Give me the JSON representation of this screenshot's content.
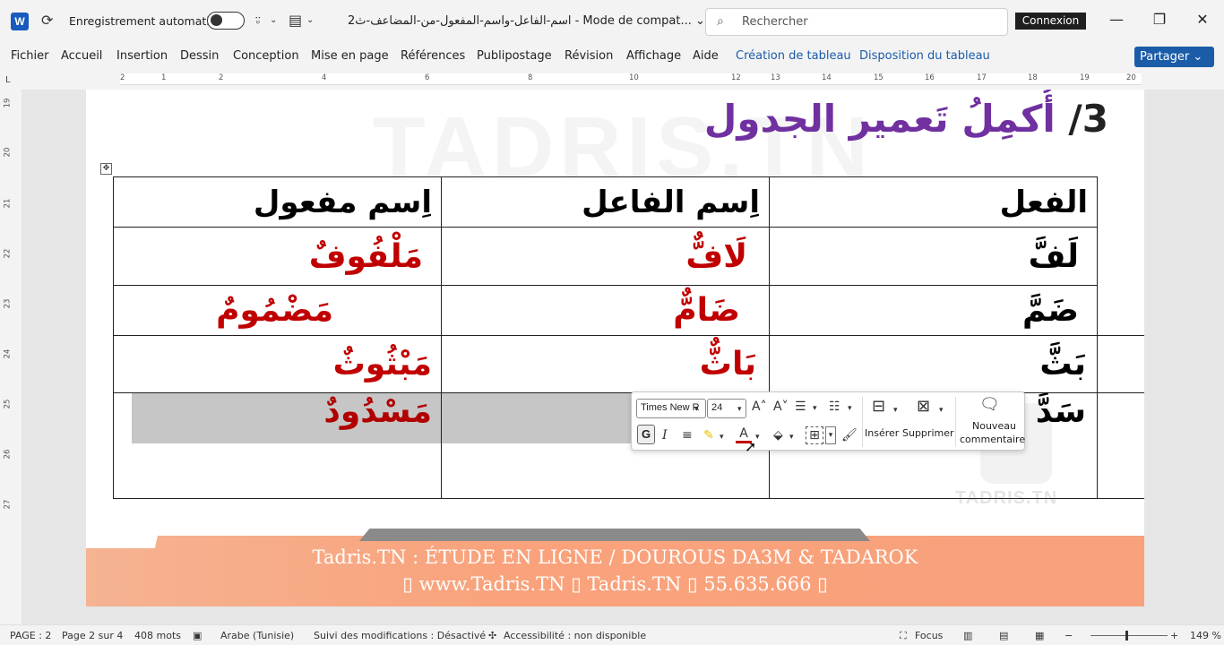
{
  "titlebar": {
    "autosave_label": "Enregistrement automatique",
    "doc_title": "اسم-الفاعل-واسم-المفعول-من-المضاعف-ث2  -  Mode de compat... ⌄",
    "search_placeholder": "Rechercher",
    "signin_label": "Connexion"
  },
  "tabs": [
    "Fichier",
    "Accueil",
    "Insertion",
    "Dessin",
    "Conception",
    "Mise en page",
    "Références",
    "Publipostage",
    "Révision",
    "Affichage",
    "Aide",
    "Création de tableau",
    "Disposition du tableau"
  ],
  "share_label": "Partager ⌄",
  "ruler": {
    "h": [
      "2",
      "1",
      "2",
      "4",
      "6",
      "8",
      "10",
      "12",
      "13",
      "14",
      "15",
      "16",
      "17",
      "18",
      "19",
      "20"
    ],
    "v": [
      "19",
      "20",
      "21",
      "22",
      "23",
      "24",
      "25",
      "26",
      "27"
    ]
  },
  "document": {
    "watermark": "TADRIS.TN",
    "heading_number": "3/",
    "heading_text": "أُكمِلُ تَعمير الجدول",
    "table": {
      "headers": [
        "الفعل",
        "اِسم  الفاعل",
        "اِسم مفعول"
      ],
      "rows": [
        {
          "verb": "لَفَّ",
          "active": "لَافٌّ",
          "passive": "مَلْفُوفٌ"
        },
        {
          "verb": "ضَمَّ",
          "active": "ضَامٌّ",
          "passive": "مَضْمُومٌ"
        },
        {
          "verb": "بَثَّ",
          "active": "بَاثٌّ",
          "passive": "مَبْثُوثٌ"
        },
        {
          "verb": "سَدَّ",
          "active": "",
          "passive": "مَسْدُودٌ"
        }
      ]
    },
    "footer_line1": "Tadris.TN : ÉTUDE EN LIGNE / DOUROUS DA3M & TADAROK",
    "footer_line2": "▯ www.Tadris.TN   ▯  Tadris.TN   ▯ 55.635.666 ▯",
    "logo_text": "TADRIS.TN"
  },
  "mini_toolbar": {
    "font_name": "Times New R",
    "font_size": "24",
    "bold_label": "G",
    "italic_label": "I",
    "insert_label": "Insérer",
    "delete_label": "Supprimer",
    "comment_label_1": "Nouveau",
    "comment_label_2": "commentaire"
  },
  "statusbar": {
    "page": "PAGE : 2",
    "page_of": "Page 2 sur 4",
    "words": "408 mots",
    "language": "Arabe (Tunisie)",
    "track_changes": "Suivi des modifications : Désactivé",
    "accessibility": "Accessibilité : non disponible",
    "focus": "Focus",
    "zoom": "149 %"
  },
  "colors": {
    "accent": "#1a5ca8",
    "heading_purple": "#7030a0",
    "answer_red": "#c00000"
  }
}
